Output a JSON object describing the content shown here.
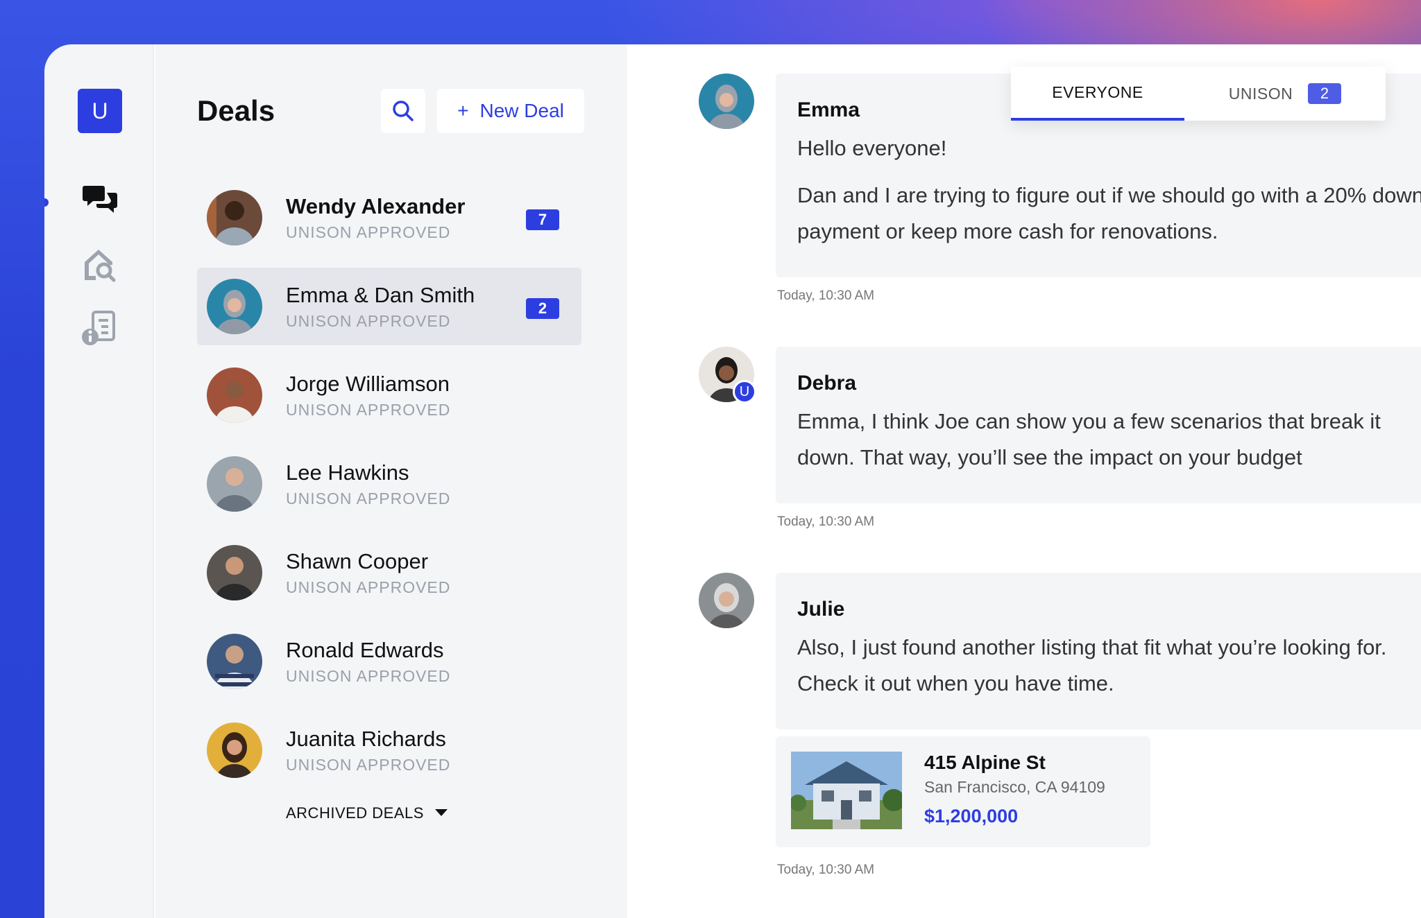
{
  "app": {
    "logo_letter": "U"
  },
  "deals_panel": {
    "title": "Deals",
    "new_deal_label": "New Deal",
    "archived_label": "ARCHIVED DEALS",
    "items": [
      {
        "name": "Wendy Alexander",
        "status": "UNISON APPROVED",
        "badge": "7",
        "avatar_color": "#6b4a3a"
      },
      {
        "name": "Emma & Dan Smith",
        "status": "UNISON APPROVED",
        "badge": "2",
        "avatar_color": "#2a86a8"
      },
      {
        "name": "Jorge Williamson",
        "status": "UNISON APPROVED",
        "badge": "",
        "avatar_color": "#a0523a"
      },
      {
        "name": "Lee Hawkins",
        "status": "UNISON APPROVED",
        "badge": "",
        "avatar_color": "#9aa5ae"
      },
      {
        "name": "Shawn Cooper",
        "status": "UNISON APPROVED",
        "badge": "",
        "avatar_color": "#5a5550"
      },
      {
        "name": "Ronald Edwards",
        "status": "UNISON APPROVED",
        "badge": "",
        "avatar_color": "#3f5a80"
      },
      {
        "name": "Juanita Richards",
        "status": "UNISON APPROVED",
        "badge": "",
        "avatar_color": "#e2b03a"
      }
    ]
  },
  "chat": {
    "tabs": {
      "everyone": "EVERYONE",
      "unison": "UNISON",
      "unison_badge": "2"
    },
    "user_badge_letter": "U",
    "messages": [
      {
        "author": "Emma",
        "lines": [
          "Hello everyone!",
          "Dan and I are trying to figure out if we should go with a 20% down",
          "payment or keep more cash for renovations."
        ],
        "time": "Today, 10:30 AM",
        "avatar_color": "#2a86a8"
      },
      {
        "author": "Debra",
        "lines": [
          "Emma, I think Joe can show you a few scenarios that break it",
          "down. That way, you’ll see the impact on your budget"
        ],
        "time": "Today, 10:30 AM",
        "avatar_color": "#e8e4e0"
      },
      {
        "author": "Julie",
        "lines": [
          "Also, I just found another listing that fit what you’re looking for.",
          "Check it out when you have time."
        ],
        "time": "Today, 10:30 AM",
        "avatar_color": "#8a8f92"
      }
    ],
    "listing": {
      "address": "415 Alpine St",
      "city": "San Francisco, CA 94109",
      "price": "$1,200,000"
    }
  },
  "colors": {
    "accent": "#2d3ee0",
    "panel_bg": "#f4f5f7",
    "muted_text": "#9aa0aa"
  }
}
